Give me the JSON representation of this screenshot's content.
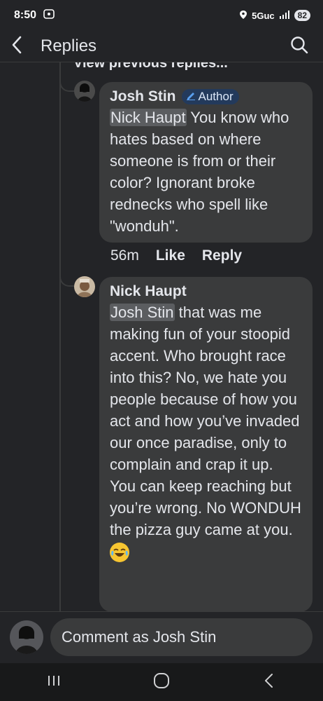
{
  "status": {
    "time": "8:50",
    "network": "5Guc",
    "battery": "82"
  },
  "header": {
    "title": "Replies"
  },
  "thread": {
    "view_previous": "View previous replies..."
  },
  "comments": [
    {
      "author": "Josh Stin",
      "badge": "Author",
      "mention": "Nick Haupt",
      "text": " You know who hates based on where someone is from or their color? Ignorant broke rednecks who spell like \"wonduh\".",
      "time": "56m",
      "like_label": "Like",
      "reply_label": "Reply"
    },
    {
      "author": "Nick Haupt",
      "mention": "Josh Stin",
      "text": " that was me making fun of your stoopid accent. Who brought race into this? No, we hate you people because of how you act and how you’ve invaded our once paradise, only to complain and crap it up. You can keep reaching but you’re wrong. No WONDUH the pizza guy came at you.",
      "emoji": "face-with-tears-of-joy"
    }
  ],
  "composer": {
    "placeholder": "Comment as Josh Stin"
  },
  "icons": {
    "back": "chevron-left-icon",
    "search": "search-icon",
    "nav_recents": "recent-apps-icon",
    "nav_home": "home-icon",
    "nav_back": "back-icon"
  },
  "colors": {
    "background": "#232427",
    "bubble": "#3a3b3c",
    "badge_bg": "#233a5c",
    "emoji": "#f7c531"
  }
}
